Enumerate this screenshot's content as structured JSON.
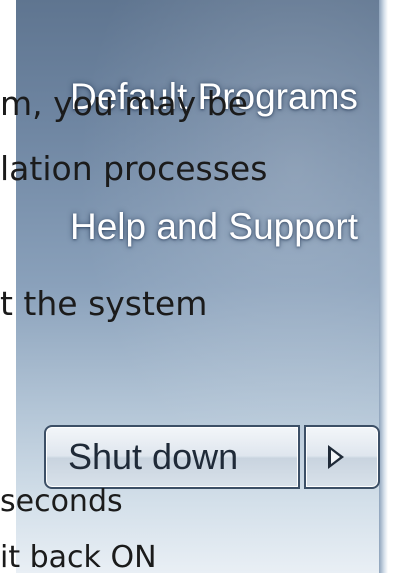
{
  "start_menu": {
    "items": [
      {
        "label": "Default Programs"
      },
      {
        "label": "Help and Support"
      }
    ],
    "shutdown_button": {
      "label": "Shut down"
    },
    "options_arrow": {
      "icon": "play-arrow-icon"
    }
  },
  "overlay_text": {
    "line1": "m, you may be",
    "line2": "lation processes",
    "line3": "t the system",
    "line4": "seconds",
    "line5": "it back ON"
  }
}
